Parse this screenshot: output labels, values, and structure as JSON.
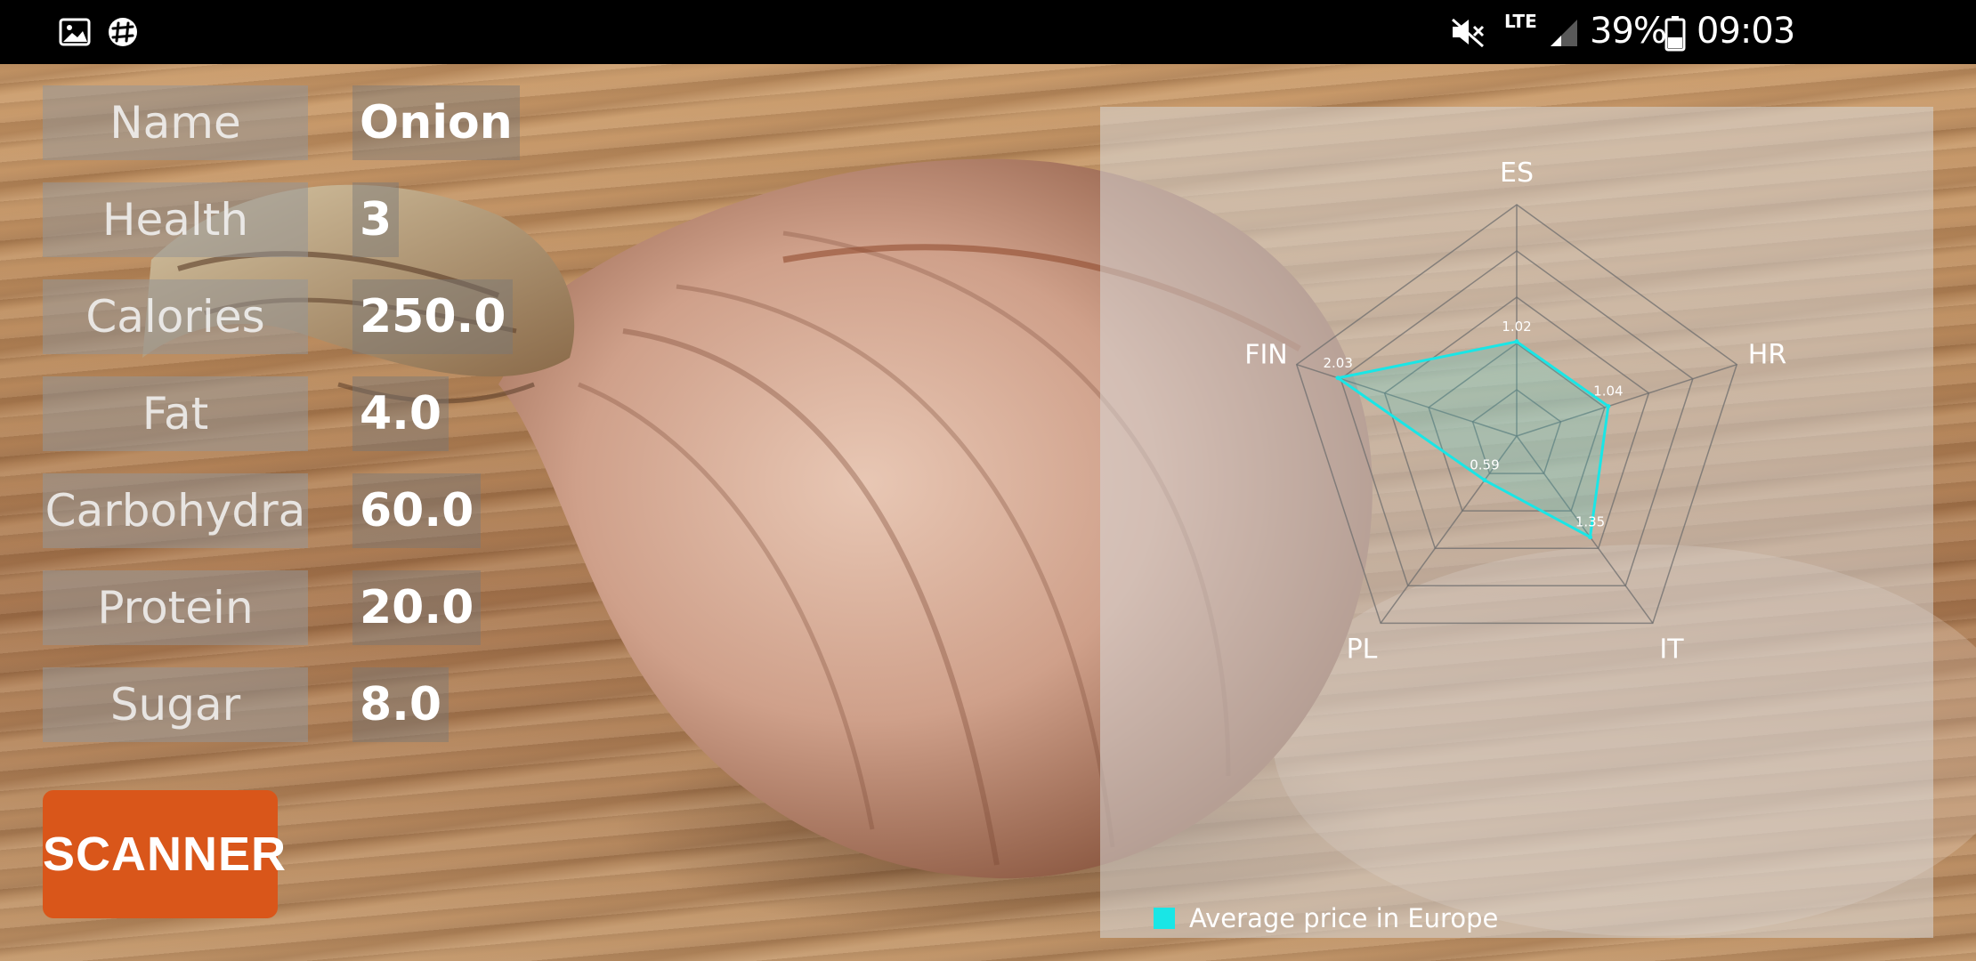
{
  "status_bar": {
    "left_icons": [
      "gallery-icon",
      "slack-icon"
    ],
    "right_icons": [
      "mute-icon",
      "signal-icon",
      "battery-icon"
    ],
    "network": "LTE",
    "battery": "39%",
    "time": "09:03"
  },
  "nutrition": {
    "rows": [
      {
        "label": "Name",
        "value": "Onion"
      },
      {
        "label": "Health",
        "value": "3"
      },
      {
        "label": "Calories",
        "value": "250.0"
      },
      {
        "label": "Fat",
        "value": "4.0"
      },
      {
        "label": "Carbohydra",
        "value": "60.0"
      },
      {
        "label": "Protein",
        "value": "20.0"
      },
      {
        "label": "Sugar",
        "value": "8.0"
      }
    ]
  },
  "scanner_button": {
    "label": "SCANNER"
  },
  "chart_data": {
    "type": "radar",
    "categories": [
      "ES",
      "HR",
      "IT",
      "PL",
      "FIN"
    ],
    "series": [
      {
        "name": "Average price in Europe",
        "values": [
          1.02,
          1.04,
          1.35,
          0.59,
          2.03
        ],
        "color": "#19e6e6"
      }
    ],
    "value_labels": [
      "1.02",
      "1.04",
      "1.35",
      "0.59",
      "2.03"
    ],
    "range": [
      0,
      2.5
    ],
    "rings": 5,
    "legend_position": "bottom-left"
  },
  "colors": {
    "accent": "#d9561a",
    "series": "#19e6e6",
    "status_bar": "#000000"
  }
}
